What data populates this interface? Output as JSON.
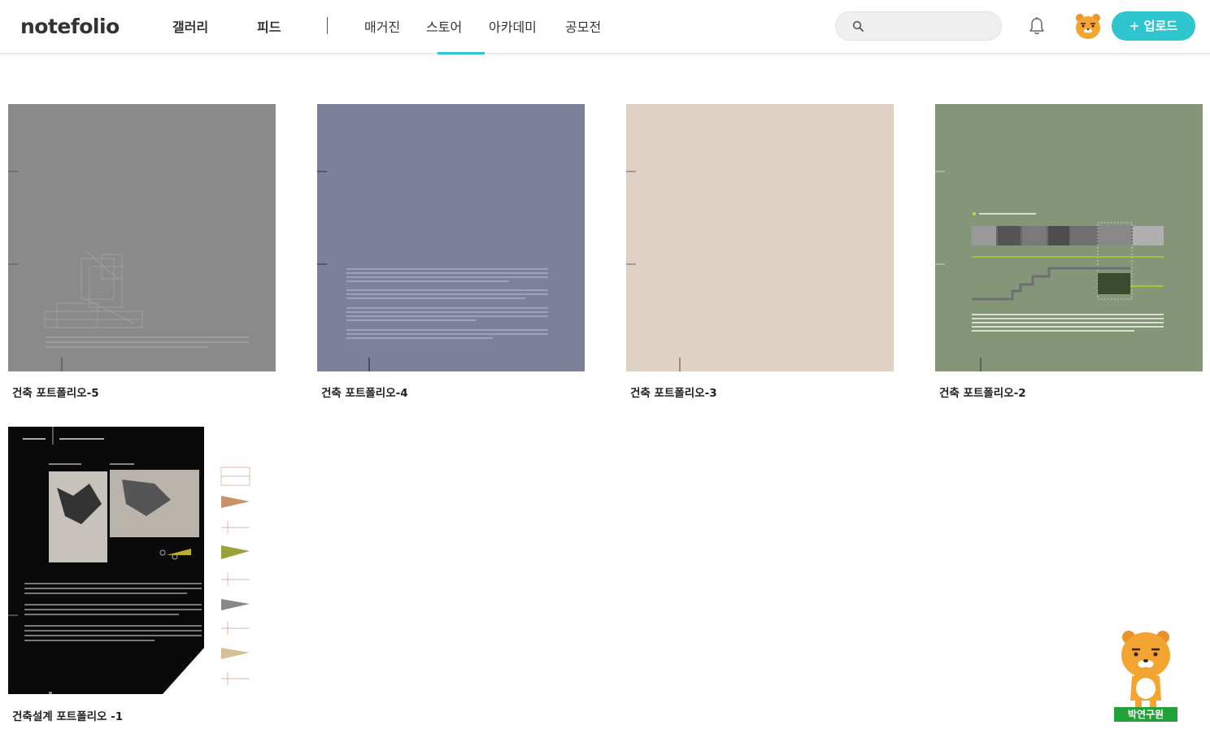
{
  "header": {
    "logo": "notefolio",
    "nav_main": [
      "갤러리",
      "피드"
    ],
    "nav_sub": [
      "매거진",
      "스토어",
      "아카데미",
      "공모전"
    ],
    "active_tab": "스토어",
    "search": {
      "value": "",
      "placeholder": ""
    },
    "upload_label": "+ 업로드",
    "accent_color": "#2ec5cf"
  },
  "cards": [
    {
      "title": "건축 포트폴리오-5",
      "bg": "#8a8a8a"
    },
    {
      "title": "건축 포트폴리오-4",
      "bg": "#7d8099"
    },
    {
      "title": "건축 포트폴리오-3",
      "bg": "#dfd1c3"
    },
    {
      "title": "건축 포트폴리오-2",
      "bg": "#849677"
    },
    {
      "title": "건축설계 포트폴리오 -1",
      "bg": "#0a0a0a"
    }
  ],
  "mascot": {
    "label": "박연구원"
  }
}
